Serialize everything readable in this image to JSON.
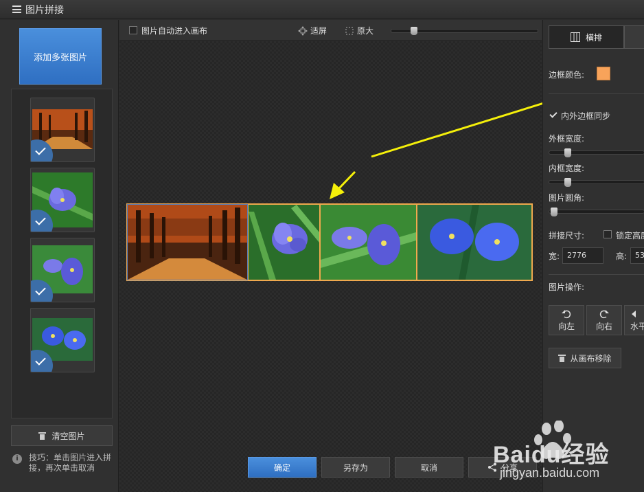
{
  "window": {
    "title": "图片拼接"
  },
  "left": {
    "add_button": "添加多张图片",
    "thumbnails": [
      {
        "name": "autumn-forest"
      },
      {
        "name": "blue-flower-1"
      },
      {
        "name": "blue-flower-2"
      },
      {
        "name": "blue-flower-3"
      }
    ],
    "clear_button": "清空图片",
    "tip": "技巧：单击图片进入拼接，再次单击取消"
  },
  "toolbar": {
    "auto_canvas_label": "图片自动进入画布",
    "fit_label": "适屏",
    "original_label": "原大",
    "zoom_fraction": 0.14
  },
  "canvas": {
    "border_color": "#f0a94e"
  },
  "bottom": {
    "ok": "确定",
    "save_as": "另存为",
    "cancel": "取消",
    "share": "分享"
  },
  "right": {
    "tab_horizontal": "横排",
    "border_color_label": "边框颜色:",
    "border_color_value": "#f8a35a",
    "sync_label": "内外边框同步",
    "outer_width_label": "外框宽度:",
    "inner_width_label": "内框宽度:",
    "corner_label": "图片圆角:",
    "size_label": "拼接尺寸:",
    "lock_label": "锁定高度",
    "width_label": "宽:",
    "width_value": "2776",
    "height_label": "高:",
    "height_value": "53",
    "ops_label": "图片操作:",
    "rotate_left": "向左",
    "rotate_right": "向右",
    "flip_h": "水平",
    "remove": "从画布移除"
  },
  "watermark": {
    "brand": "Baidu经验",
    "url": "jingyan.baidu.com"
  }
}
